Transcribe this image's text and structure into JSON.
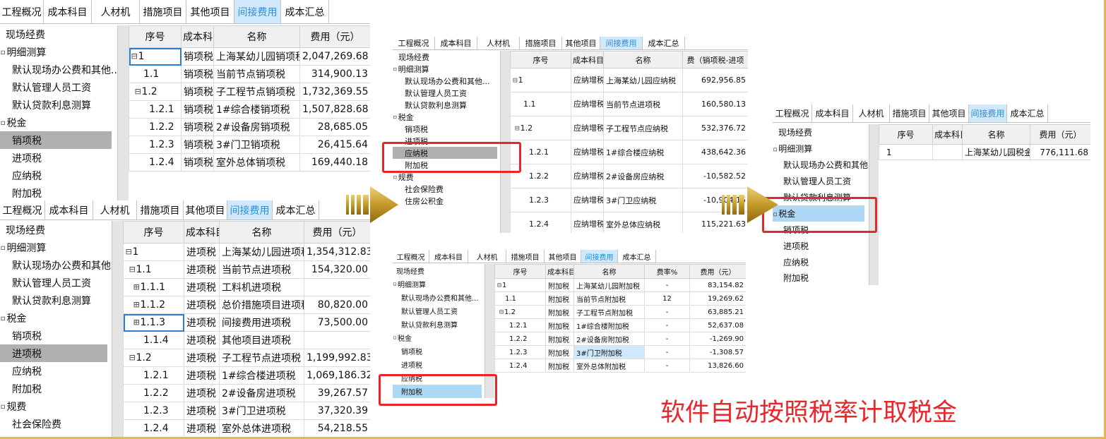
{
  "tabs": [
    "工程概况",
    "成本科目",
    "人材机",
    "措施项目",
    "其他项目",
    "间接费用",
    "成本汇总"
  ],
  "active_tab": "间接费用",
  "slogan": "软件自动按照税率计取税金",
  "icons": {
    "arrow": "gold-right-arrow-icon",
    "expand": "tree-toggle-icon"
  },
  "colors": {
    "highlight": "#e8262b",
    "arrow": "#c9a02c",
    "selected_tab": "#cfe8fb"
  },
  "tree_full": [
    {
      "label": "现场经费",
      "level": 0,
      "toggle": ""
    },
    {
      "label": "明细测算",
      "level": 0,
      "toggle": "⊟"
    },
    {
      "label": "默认现场办公费和其他...",
      "level": 1,
      "toggle": ""
    },
    {
      "label": "默认管理人员工资",
      "level": 1,
      "toggle": ""
    },
    {
      "label": "默认贷款利息测算",
      "level": 1,
      "toggle": ""
    },
    {
      "label": "税金",
      "level": 0,
      "toggle": "⊟"
    },
    {
      "label": "销项税",
      "level": 1,
      "toggle": ""
    },
    {
      "label": "进项税",
      "level": 1,
      "toggle": ""
    },
    {
      "label": "应纳税",
      "level": 1,
      "toggle": ""
    },
    {
      "label": "附加税",
      "level": 1,
      "toggle": ""
    },
    {
      "label": "规费",
      "level": 0,
      "toggle": "⊟"
    },
    {
      "label": "社会保险费",
      "level": 1,
      "toggle": ""
    },
    {
      "label": "住房公积金",
      "level": 1,
      "toggle": ""
    }
  ],
  "panel_sales": {
    "headers": [
      "序号",
      "成本科目",
      "名称",
      "费用（元）"
    ],
    "rows": [
      [
        "1",
        "销项税",
        "上海某幼儿园销项税",
        "2,047,269.68"
      ],
      [
        "1.1",
        "销项税",
        "当前节点销项税",
        "314,900.13"
      ],
      [
        "1.2",
        "销项税",
        "子工程节点销项税",
        "1,732,369.55"
      ],
      [
        "1.2.1",
        "销项税",
        "1#综合楼销项税",
        "1,507,828.68"
      ],
      [
        "1.2.2",
        "销项税",
        "2#设备房销项税",
        "28,685.05"
      ],
      [
        "1.2.3",
        "销项税",
        "3#门卫销项税",
        "26,415.64"
      ],
      [
        "1.2.4",
        "销项税",
        "室外总体销项税",
        "169,440.18"
      ]
    ]
  },
  "panel_input": {
    "headers": [
      "序号",
      "成本科目",
      "名称",
      "费用（元）"
    ],
    "rows": [
      [
        "1",
        "进项税",
        "上海某幼儿园进项税",
        "1,354,312.83"
      ],
      [
        "1.1",
        "进项税",
        "当前节点进项税",
        "154,320.00"
      ],
      [
        "1.1.1",
        "进项税",
        "工料机进项税",
        ""
      ],
      [
        "1.1.2",
        "进项税",
        "总价措施项目进项税",
        "80,820.00"
      ],
      [
        "1.1.3",
        "进项税",
        "间接费用进项税",
        "73,500.00"
      ],
      [
        "1.1.4",
        "进项税",
        "其他项目进项税",
        ""
      ],
      [
        "1.2",
        "进项税",
        "子工程节点进项税",
        "1,199,992.83"
      ],
      [
        "1.2.1",
        "进项税",
        "1#综合楼进项税",
        "1,069,186.32"
      ],
      [
        "1.2.2",
        "进项税",
        "2#设备房进项税",
        "39,267.57"
      ],
      [
        "1.2.3",
        "进项税",
        "3#门卫进项税",
        "37,320.39"
      ],
      [
        "1.2.4",
        "进项税",
        "室外总体进项税",
        "54,218.55"
      ]
    ]
  },
  "panel_payable": {
    "headers": [
      "序号",
      "成本科目",
      "名称",
      "费（销项税-进项"
    ],
    "rows": [
      [
        "1",
        "应纳增税值",
        "上海某幼儿园应纳税",
        "692,956.85"
      ],
      [
        "1.1",
        "应纳增税值",
        "当前节点进项税",
        "160,580.13"
      ],
      [
        "1.2",
        "应纳增税值",
        "子工程节点应纳税",
        "532,376.72"
      ],
      [
        "1.2.1",
        "应纳增税值",
        "1#综合楼应纳税",
        "438,642.36"
      ],
      [
        "1.2.2",
        "应纳增税值",
        "2#设备房应纳税",
        "-10,582.52"
      ],
      [
        "1.2.3",
        "应纳增税值",
        "3#门卫应纳税",
        "-10,904.15"
      ],
      [
        "1.2.4",
        "应纳增税值",
        "室外总体应纳税",
        "115,221.63"
      ]
    ]
  },
  "panel_surcharge": {
    "headers": [
      "序号",
      "成本科目",
      "名称",
      "费率%",
      "费用（元）"
    ],
    "rows": [
      [
        "1",
        "附加税",
        "上海某幼儿园附加税",
        "-",
        "83,154.82"
      ],
      [
        "1.1",
        "附加税",
        "当前节点附加税",
        "12",
        "19,269.62"
      ],
      [
        "1.2",
        "附加税",
        "子工程节点附加税",
        "-",
        "63,885.21"
      ],
      [
        "1.2.1",
        "附加税",
        "1#综合楼附加税",
        "-",
        "52,637.08"
      ],
      [
        "1.2.2",
        "附加税",
        "2#设备房附加税",
        "-",
        "-1,269.90"
      ],
      [
        "1.2.3",
        "附加税",
        "3#门卫附加税",
        "-",
        "-1,308.57"
      ],
      [
        "1.2.4",
        "附加税",
        "室外总体附加税",
        "-",
        "13,826.60"
      ]
    ]
  },
  "panel_total": {
    "headers": [
      "序号",
      "成本科目",
      "名称",
      "费用（元）"
    ],
    "rows": [
      [
        "1",
        "",
        "上海某幼儿园税金",
        "776,111.68"
      ]
    ]
  }
}
